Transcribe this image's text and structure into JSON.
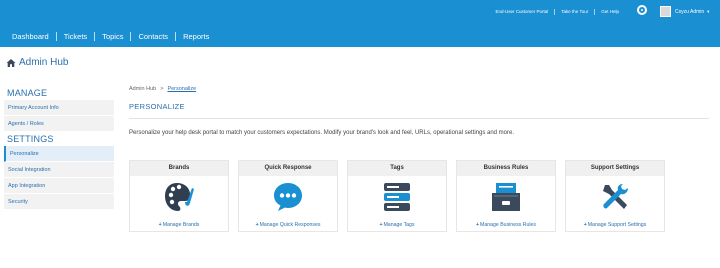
{
  "header": {
    "links": [
      "End-User Customer Portal",
      "Take the Tour",
      "Get Help"
    ],
    "user_name": "Csyzu Admin",
    "nav": [
      "Dashboard",
      "Tickets",
      "Topics",
      "Contacts",
      "Reports"
    ]
  },
  "hub_title": "Admin Hub",
  "sidebar": {
    "manage_heading": "MANAGE",
    "manage_items": [
      "Primary Account Info",
      "Agents / Roles"
    ],
    "settings_heading": "SETTINGS",
    "settings_items": [
      "Personalize",
      "Social Integration",
      "App Integration",
      "Security"
    ],
    "active_item": "Personalize"
  },
  "breadcrumb": {
    "root": "Admin Hub",
    "separator": ">",
    "current": "Personalize"
  },
  "page": {
    "title": "PERSONALIZE",
    "description": "Personalize your help desk portal to match your customers expectations. Modify your brand's look and feel, URLs, operational settings and more."
  },
  "cards": [
    {
      "title": "Brands",
      "action": "Manage Brands",
      "icon": "palette-icon",
      "color": "#1a8fd1"
    },
    {
      "title": "Quick Response",
      "action": "Manage Quick Responses",
      "icon": "chat-bubble-icon",
      "color": "#1a8fd1"
    },
    {
      "title": "Tags",
      "action": "Manage Tags",
      "icon": "tags-stack-icon",
      "color": "#3a4a5c"
    },
    {
      "title": "Business Rules",
      "action": "Manage Business Rules",
      "icon": "file-cabinet-icon",
      "color": "#3a4a5c"
    },
    {
      "title": "Support Settings",
      "action": "Manage Support Settings",
      "icon": "tools-icon",
      "color": "#1a8fd1"
    }
  ]
}
